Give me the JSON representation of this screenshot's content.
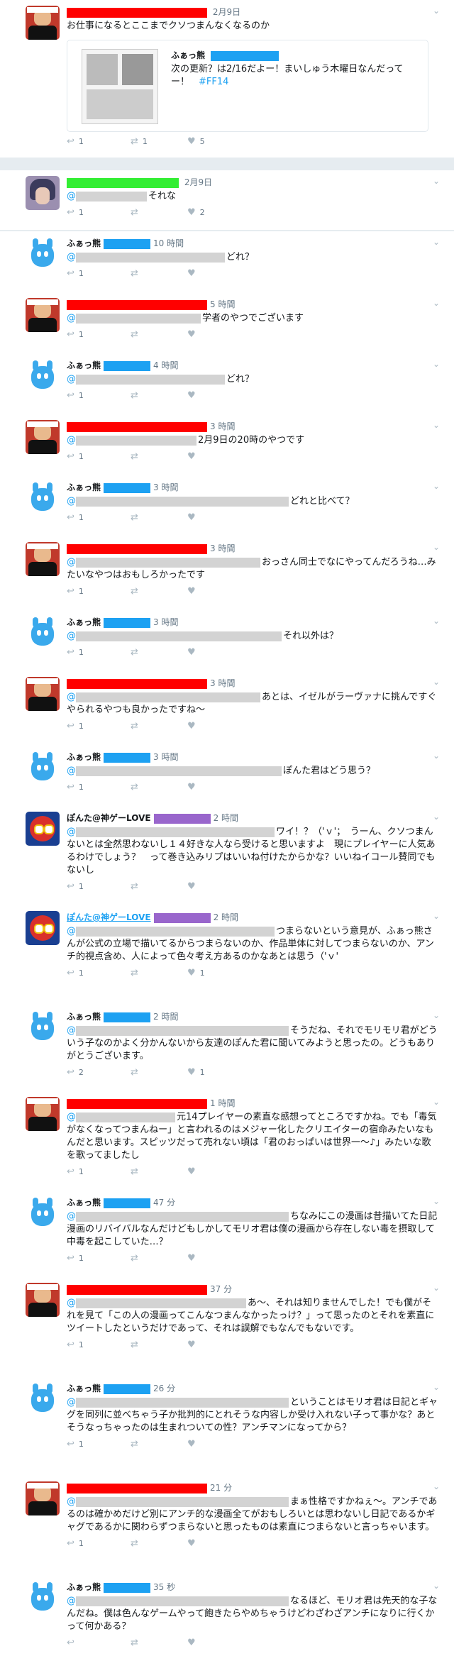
{
  "colors": {
    "accent": "#1da1f2",
    "redact_red": "#ff0000",
    "redact_blue": "#1da1f2",
    "redact_green": "#33ee33",
    "redact_purple": "#9966cc",
    "redact_gray": "#d3d3d3"
  },
  "icons": {
    "reply": "reply-icon",
    "retweet": "retweet-icon",
    "like": "heart-icon",
    "more": "chevron-down-icon"
  },
  "tweets": [
    {
      "user": "",
      "time": "2月9日",
      "text": "お仕事になるとここまでクソつまんなくなるのか",
      "card": {
        "user": "ふぁっ熊",
        "text": "次の更新？は2/16だよー！まいしゅう木曜日なんだってー！",
        "hashtag": "#FF14"
      },
      "replies": "1",
      "retweets": "1",
      "likes": "5"
    },
    {
      "user": "",
      "time": "2月9日",
      "mention": "@",
      "text": "それな",
      "replies": "1",
      "retweets": "",
      "likes": "2"
    },
    {
      "user": "ふぁっ熊",
      "time": "10 時間",
      "mention": "@",
      "text": "どれ？",
      "replies": "1",
      "retweets": "",
      "likes": ""
    },
    {
      "user": "",
      "time": "5 時間",
      "mention": "@",
      "text": "学者のやつでございます",
      "replies": "1",
      "retweets": "",
      "likes": ""
    },
    {
      "user": "ふぁっ熊",
      "time": "4 時間",
      "mention": "@",
      "text": "どれ？",
      "replies": "1",
      "retweets": "",
      "likes": ""
    },
    {
      "user": "",
      "time": "3 時間",
      "mention": "@",
      "text": "2月9日の20時のやつです",
      "replies": "1",
      "retweets": "",
      "likes": ""
    },
    {
      "user": "ふぁっ熊",
      "time": "3 時間",
      "mention": "@",
      "text": "どれと比べて？",
      "replies": "1",
      "retweets": "",
      "likes": ""
    },
    {
      "user": "",
      "time": "3 時間",
      "mention": "@",
      "text": "おっさん同士でなにやってんだろうね…みたいなやつはおもしろかったです",
      "replies": "1",
      "retweets": "",
      "likes": ""
    },
    {
      "user": "ふぁっ熊",
      "time": "3 時間",
      "mention": "@",
      "text": "それ以外は？",
      "replies": "1",
      "retweets": "",
      "likes": ""
    },
    {
      "user": "",
      "time": "3 時間",
      "mention": "@",
      "text": "あとは、イゼルがラーヴァナに挑んですぐやられるやつも良かったですね～",
      "replies": "1",
      "retweets": "",
      "likes": ""
    },
    {
      "user": "ふぁっ熊",
      "time": "3 時間",
      "mention": "@",
      "text": "ぽんた君はどう思う？",
      "replies": "1",
      "retweets": "",
      "likes": ""
    },
    {
      "user": "ぽんた@神ゲーLOVE",
      "time": "2 時間",
      "mention": "@",
      "text": "ワイ！？（'ｖ'；　うーん、クソつまんないとは全然思わないし１４好きな人なら受けると思いますよ　現にプレイヤーに人気あるわけでしょう？　って巻き込みリプはいいね付けたからかな？いいねイコール賛同でもないし",
      "replies": "1",
      "retweets": "",
      "likes": ""
    },
    {
      "user": "ぽんた@神ゲーLOVE",
      "time": "2 時間",
      "mention": "@",
      "text": "つまらないという意見が、ふぁっ熊さんが公式の立場で描いてるからつまらないのか、作品単体に対してつまらないのか、アンチ的視点含め、人によって色々考え方あるのかなあとは思う（'ｖ'",
      "replies": "1",
      "retweets": "",
      "likes": "1"
    },
    {
      "user": "ふぁっ熊",
      "time": "2 時間",
      "mention": "@",
      "text": "そうだね、それでモリモリ君がどういう子なのかよく分かんないから友達のぽんた君に聞いてみようと思ったの。どうもありがとうございます。",
      "replies": "2",
      "retweets": "",
      "likes": "1"
    },
    {
      "user": "",
      "time": "1 時間",
      "mention": "@",
      "text": "元14プレイヤーの素直な感想ってところですかね。でも「毒気がなくなってつまんねー」と言われるのはメジャー化したクリエイターの宿命みたいなもんだと思います。スピッツだって売れない頃は「君のおっぱいは世界一～♪」みたいな歌を歌ってましたし",
      "replies": "1",
      "retweets": "",
      "likes": ""
    },
    {
      "user": "ふぁっ熊",
      "time": "47 分",
      "mention": "@",
      "text": "ちなみにこの漫画は昔描いてた日記漫画のリバイバルなんだけどもしかしてモリオ君は僕の漫画から存在しない毒を摂取して中毒を起こしていた…？",
      "replies": "1",
      "retweets": "",
      "likes": ""
    },
    {
      "user": "",
      "time": "37 分",
      "mention": "@",
      "text": "あ～、それは知りませんでした！でも僕がそれを見て「この人の漫画ってこんなつまんなかったっけ？」って思ったのとそれを素直にツイートしたというだけであって、それは誤解でもなんでもないです。",
      "replies": "1",
      "retweets": "",
      "likes": ""
    },
    {
      "user": "ふぁっ熊",
      "time": "26 分",
      "mention": "@",
      "text": "ということはモリオ君は日記とギャグを同列に並べちゃう子か批判的にとれそうな内容しか受け入れない子って事かな？あとそうなっちゃったのは生まれついての性？アンチマンになってから？",
      "replies": "1",
      "retweets": "",
      "likes": ""
    },
    {
      "user": "",
      "time": "21 分",
      "mention": "@",
      "text": "まぁ性格ですかねぇ～。アンチであるのは確かめだけど別にアンチ的な漫画全てがおもしろいとは思わないし日記であるかギャグであるかに関わらずつまらないと思ったものは素直につまらないと言っちゃいます。",
      "replies": "1",
      "retweets": "",
      "likes": ""
    },
    {
      "user": "ふぁっ熊",
      "time": "35 秒",
      "mention": "@",
      "text": "なるほど、モリオ君は先天的な子なんだね。僕は色んなゲームやって飽きたらやめちゃうけどわざわざアンチになりに行くかって何かある？",
      "replies": "",
      "retweets": "",
      "likes": ""
    }
  ]
}
